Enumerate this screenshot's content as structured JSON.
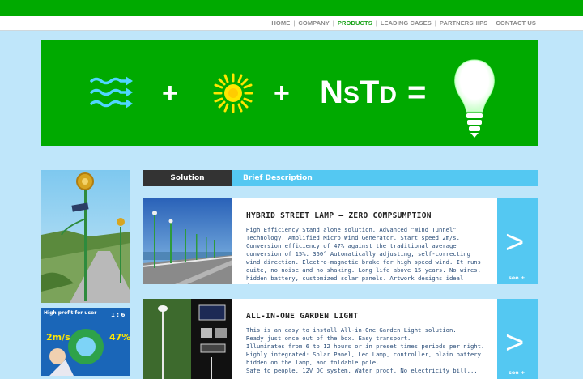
{
  "nav": {
    "items": [
      {
        "label": "HOME"
      },
      {
        "label": "COMPANY"
      },
      {
        "label": "PRODUCTS"
      },
      {
        "label": "LEADING CASES"
      },
      {
        "label": "PARTNERSHIPS"
      },
      {
        "label": "CONTACT US"
      }
    ],
    "active": "PRODUCTS"
  },
  "banner": {
    "plus1": "+",
    "plus2": "+",
    "equals": "=",
    "logo_text": "NSTD",
    "icons": [
      "wind-icon",
      "sun-icon",
      "lightbulb-icon"
    ]
  },
  "tabs": {
    "solution": "Solution",
    "brief": "Brief Description"
  },
  "products": [
    {
      "title": "HYBRID STREET LAMP – ZERO COMPSUMPTION",
      "description": "High Efficiency Stand alone solution. Advanced \"Wind Tunnel\" Technology. Amplified Micro Wind Generator. Start speed 2m/s. Conversion efficiency of 47% against the traditional average conversion of 15%. 360° Automatically adjusting, self-correcting wind direction. Electro-magnetic brake for high speed wind. It runs quite, no noise and no shaking. Long life above 15 years. No wires, hidden battery, customized solar panels. Artwork designs ideal for...",
      "more": "see +",
      "arrow": ">"
    },
    {
      "title": "ALL-IN-ONE GARDEN LIGHT",
      "description_lines": [
        "This is an easy to install All-in-One Garden Light solution.",
        "Ready just once out of the box. Easy transport.",
        "Illuminates from 6 to 12 hours or in preset times periods per night.",
        "Highly integrated: Solar Panel, Led Lamp, controller, plain battery hidden on the lamp, and foldable pole.",
        "Safe to people, 12V DC system. Water proof. No electricity bill..."
      ],
      "more": "see +",
      "arrow": ">"
    }
  ],
  "promo": {
    "headline": "High profit for user",
    "ratio": "1 : 6",
    "speed": "2m/s",
    "efficiency": "47%"
  },
  "colors": {
    "brand_green": "#00aa00",
    "accent_blue": "#54c8f2",
    "background": "#bfe6fa",
    "dark_tab": "#333333",
    "desc_text": "#2a4d78"
  }
}
